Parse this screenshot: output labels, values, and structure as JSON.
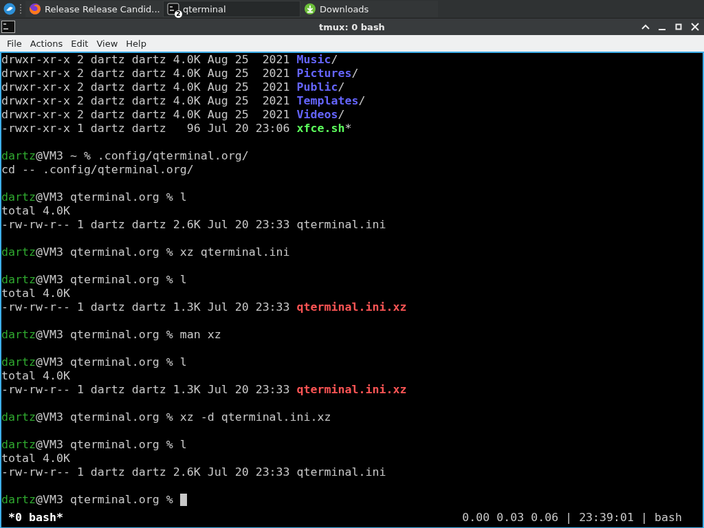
{
  "taskbar": {
    "tasks": [
      {
        "label": "Release Release Candid...",
        "kind": "browser",
        "selected": false
      },
      {
        "label": "qterminal",
        "kind": "terminal",
        "badge": "2",
        "selected": true
      },
      {
        "label": "Downloads",
        "kind": "download",
        "selected": false
      }
    ]
  },
  "window": {
    "title": "tmux: 0 bash"
  },
  "menu": [
    "File",
    "Actions",
    "Edit",
    "View",
    "Help"
  ],
  "terminal": {
    "lines": [
      {
        "kind": "text",
        "segments": [
          {
            "text": "drwxr-xr-x 2 dartz dartz 4.0K Aug 25  2021 ",
            "kind": "plain"
          },
          {
            "text": "Music",
            "kind": "dir"
          },
          {
            "text": "/",
            "kind": "plain"
          }
        ]
      },
      {
        "kind": "text",
        "segments": [
          {
            "text": "drwxr-xr-x 2 dartz dartz 4.0K Aug 25  2021 ",
            "kind": "plain"
          },
          {
            "text": "Pictures",
            "kind": "dir"
          },
          {
            "text": "/",
            "kind": "plain"
          }
        ]
      },
      {
        "kind": "text",
        "segments": [
          {
            "text": "drwxr-xr-x 2 dartz dartz 4.0K Aug 25  2021 ",
            "kind": "plain"
          },
          {
            "text": "Public",
            "kind": "dir"
          },
          {
            "text": "/",
            "kind": "plain"
          }
        ]
      },
      {
        "kind": "text",
        "segments": [
          {
            "text": "drwxr-xr-x 2 dartz dartz 4.0K Aug 25  2021 ",
            "kind": "plain"
          },
          {
            "text": "Templates",
            "kind": "dir"
          },
          {
            "text": "/",
            "kind": "plain"
          }
        ]
      },
      {
        "kind": "text",
        "segments": [
          {
            "text": "drwxr-xr-x 2 dartz dartz 4.0K Aug 25  2021 ",
            "kind": "plain"
          },
          {
            "text": "Videos",
            "kind": "dir"
          },
          {
            "text": "/",
            "kind": "plain"
          }
        ]
      },
      {
        "kind": "text",
        "segments": [
          {
            "text": "-rwxr-xr-x 1 dartz dartz   96 Jul 20 23:06 ",
            "kind": "plain"
          },
          {
            "text": "xfce.sh",
            "kind": "exec"
          },
          {
            "text": "*",
            "kind": "plain"
          }
        ]
      },
      {
        "kind": "blank"
      },
      {
        "kind": "text",
        "segments": [
          {
            "text": "dartz",
            "kind": "user"
          },
          {
            "text": "@VM3 ~ % .config/qterminal.org/",
            "kind": "plain"
          }
        ]
      },
      {
        "kind": "text",
        "segments": [
          {
            "text": "cd -- .config/qterminal.org/",
            "kind": "plain"
          }
        ]
      },
      {
        "kind": "blank"
      },
      {
        "kind": "text",
        "segments": [
          {
            "text": "dartz",
            "kind": "user"
          },
          {
            "text": "@VM3 qterminal.org % l",
            "kind": "plain"
          }
        ]
      },
      {
        "kind": "text",
        "segments": [
          {
            "text": "total 4.0K",
            "kind": "plain"
          }
        ]
      },
      {
        "kind": "text",
        "segments": [
          {
            "text": "-rw-rw-r-- 1 dartz dartz 2.6K Jul 20 23:33 qterminal.ini",
            "kind": "plain"
          }
        ]
      },
      {
        "kind": "blank"
      },
      {
        "kind": "text",
        "segments": [
          {
            "text": "dartz",
            "kind": "user"
          },
          {
            "text": "@VM3 qterminal.org % xz qterminal.ini",
            "kind": "plain"
          }
        ]
      },
      {
        "kind": "blank"
      },
      {
        "kind": "text",
        "segments": [
          {
            "text": "dartz",
            "kind": "user"
          },
          {
            "text": "@VM3 qterminal.org % l",
            "kind": "plain"
          }
        ]
      },
      {
        "kind": "text",
        "segments": [
          {
            "text": "total 4.0K",
            "kind": "plain"
          }
        ]
      },
      {
        "kind": "text",
        "segments": [
          {
            "text": "-rw-rw-r-- 1 dartz dartz 1.3K Jul 20 23:33 ",
            "kind": "plain"
          },
          {
            "text": "qterminal.ini.xz",
            "kind": "archive"
          }
        ]
      },
      {
        "kind": "blank"
      },
      {
        "kind": "text",
        "segments": [
          {
            "text": "dartz",
            "kind": "user"
          },
          {
            "text": "@VM3 qterminal.org % man xz",
            "kind": "plain"
          }
        ]
      },
      {
        "kind": "blank"
      },
      {
        "kind": "text",
        "segments": [
          {
            "text": "dartz",
            "kind": "user"
          },
          {
            "text": "@VM3 qterminal.org % l",
            "kind": "plain"
          }
        ]
      },
      {
        "kind": "text",
        "segments": [
          {
            "text": "total 4.0K",
            "kind": "plain"
          }
        ]
      },
      {
        "kind": "text",
        "segments": [
          {
            "text": "-rw-rw-r-- 1 dartz dartz 1.3K Jul 20 23:33 ",
            "kind": "plain"
          },
          {
            "text": "qterminal.ini.xz",
            "kind": "archive"
          }
        ]
      },
      {
        "kind": "blank"
      },
      {
        "kind": "text",
        "segments": [
          {
            "text": "dartz",
            "kind": "user"
          },
          {
            "text": "@VM3 qterminal.org % xz -d qterminal.ini.xz",
            "kind": "plain"
          }
        ]
      },
      {
        "kind": "blank"
      },
      {
        "kind": "text",
        "segments": [
          {
            "text": "dartz",
            "kind": "user"
          },
          {
            "text": "@VM3 qterminal.org % l",
            "kind": "plain"
          }
        ]
      },
      {
        "kind": "text",
        "segments": [
          {
            "text": "total 4.0K",
            "kind": "plain"
          }
        ]
      },
      {
        "kind": "text",
        "segments": [
          {
            "text": "-rw-rw-r-- 1 dartz dartz 2.6K Jul 20 23:33 qterminal.ini",
            "kind": "plain"
          }
        ]
      },
      {
        "kind": "blank"
      },
      {
        "kind": "text",
        "cursor": true,
        "segments": [
          {
            "text": "dartz",
            "kind": "user"
          },
          {
            "text": "@VM3 qterminal.org % ",
            "kind": "plain"
          }
        ]
      }
    ],
    "status": {
      "left": "*0 bash*",
      "right": "0.00 0.03 0.06 | 23:39:01 | bash"
    }
  }
}
